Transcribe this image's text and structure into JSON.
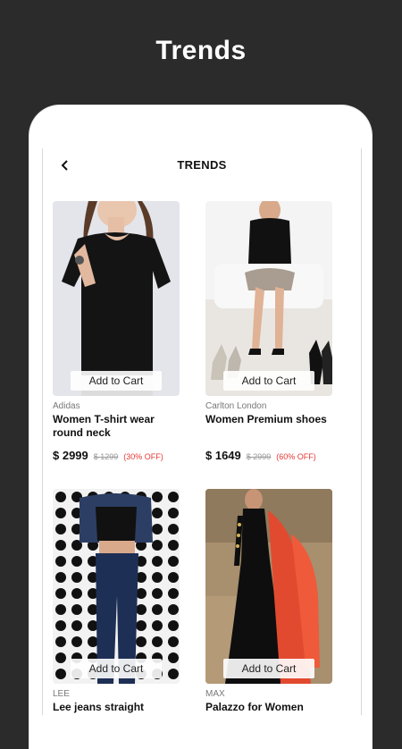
{
  "banner": {
    "title": "Trends"
  },
  "header": {
    "title": "TRENDS",
    "back_icon": "chevron-left-icon"
  },
  "products": [
    {
      "brand": "Adidas",
      "name": "Women T-shirt wear round neck",
      "price": "$ 2999",
      "old_price": "$ 1299",
      "discount": "(30% OFF)",
      "cta": "Add to Cart"
    },
    {
      "brand": "Carlton London",
      "name": "Women Premium shoes",
      "price": "$ 1649",
      "old_price": "$ 2999",
      "discount": "(60% OFF)",
      "cta": "Add to Cart"
    },
    {
      "brand": "LEE",
      "name": "Lee jeans straight",
      "cta": "Add to Cart"
    },
    {
      "brand": "MAX",
      "name": "Palazzo for Women",
      "cta": "Add to Cart"
    }
  ],
  "colors": {
    "background": "#2b2b2b",
    "discount": "#e53935",
    "card_bg": "#ffffff"
  }
}
